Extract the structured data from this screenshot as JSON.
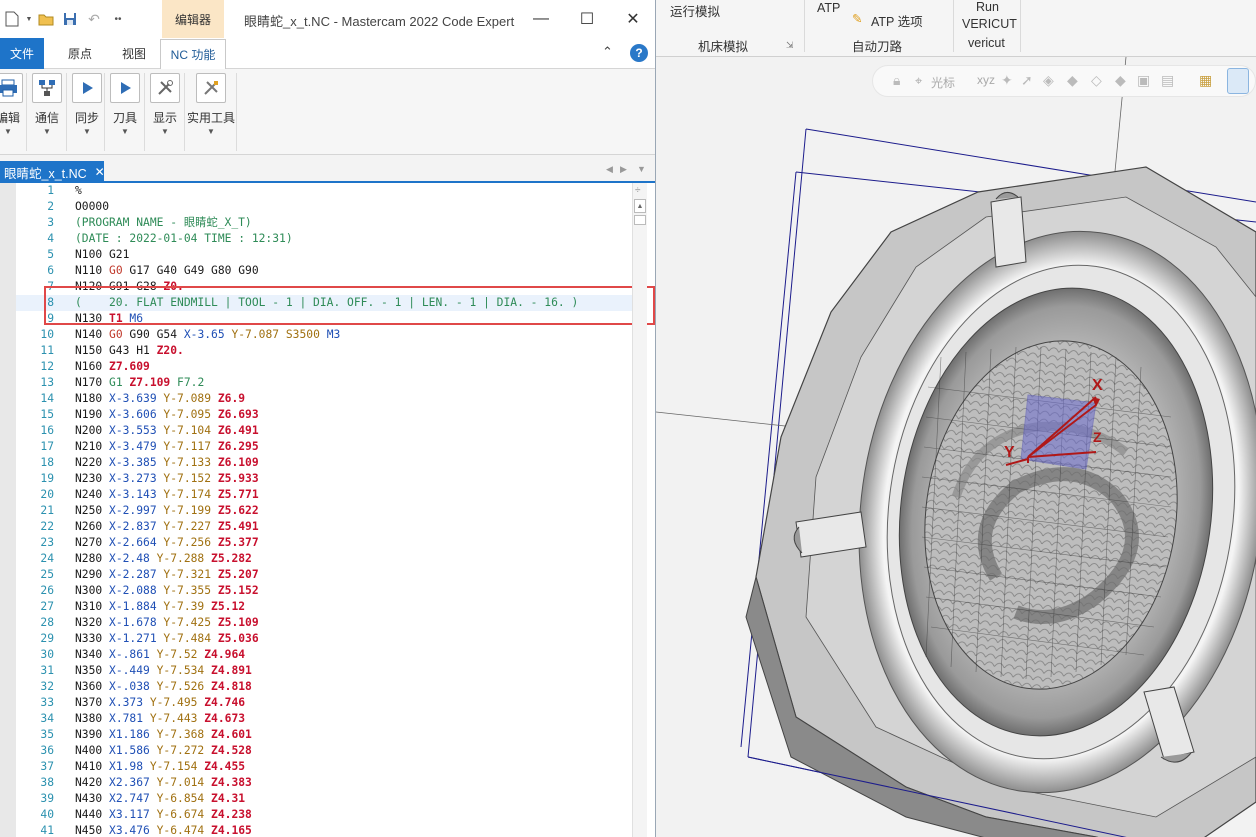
{
  "code_expert": {
    "title": "眼睛蛇_x_t.NC - Mastercam 2022 Code Expert",
    "contextual_tab": "编辑器",
    "window_buttons": {
      "minimize": "—",
      "maximize": "☐",
      "close": "✕"
    },
    "ribbon_tabs": {
      "file": "文件",
      "origin": "原点",
      "view": "视图",
      "nc": "NC 功能"
    },
    "help": "?",
    "ribbon_buttons": {
      "edit": "编辑",
      "comm": "通信",
      "sync": "同步",
      "tool": "刀具",
      "display": "显示",
      "utilities": "实用工具"
    },
    "doc_tab": {
      "label": "眼睛蛇_x_t.NC",
      "close": "✕"
    },
    "lines": [
      [
        "1",
        [
          [
            "o",
            "%"
          ]
        ]
      ],
      [
        "2",
        [
          [
            "o",
            "O0000"
          ]
        ]
      ],
      [
        "3",
        [
          [
            "c",
            "(PROGRAM NAME - 眼睛蛇_X_T)"
          ]
        ]
      ],
      [
        "4",
        [
          [
            "c",
            "(DATE : 2022-01-04 TIME : 12:31)"
          ]
        ]
      ],
      [
        "5",
        [
          [
            "n",
            "N100 G21"
          ]
        ]
      ],
      [
        "6",
        [
          [
            "n",
            "N110 "
          ],
          [
            "g0",
            "G0"
          ],
          [
            "n",
            " G17 G40 G49 G80 G90"
          ]
        ]
      ],
      [
        "7",
        [
          [
            "n",
            "N120 G91 G28 "
          ],
          [
            "z",
            "Z0."
          ]
        ]
      ],
      [
        "8",
        [
          [
            "c",
            "(    20. FLAT ENDMILL | TOOL - 1 | DIA. OFF. - 1 | LEN. - 1 | DIA. - 16. )"
          ]
        ]
      ],
      [
        "9",
        [
          [
            "n",
            "N130 "
          ],
          [
            "t",
            "T1"
          ],
          [
            "m",
            " M6"
          ]
        ]
      ],
      [
        "10",
        [
          [
            "n",
            "N140 "
          ],
          [
            "g0",
            "G0"
          ],
          [
            "n",
            " G90 G54 "
          ],
          [
            "x",
            "X-3.65"
          ],
          [
            "y",
            " Y-7.087"
          ],
          [
            "s",
            " S3500"
          ],
          [
            "m",
            " M3"
          ]
        ]
      ],
      [
        "11",
        [
          [
            "n",
            "N150 G43 H1 "
          ],
          [
            "z",
            "Z20."
          ]
        ]
      ],
      [
        "12",
        [
          [
            "n",
            "N160 "
          ],
          [
            "z",
            "Z7.609"
          ]
        ]
      ],
      [
        "13",
        [
          [
            "n",
            "N170 "
          ],
          [
            "g1",
            "G1"
          ],
          [
            "z",
            " Z7.109"
          ],
          [
            "f",
            " F7.2"
          ]
        ]
      ],
      [
        "14",
        [
          [
            "n",
            "N180 "
          ],
          [
            "x",
            "X-3.639"
          ],
          [
            "y",
            " Y-7.089"
          ],
          [
            "z",
            " Z6.9"
          ]
        ]
      ],
      [
        "15",
        [
          [
            "n",
            "N190 "
          ],
          [
            "x",
            "X-3.606"
          ],
          [
            "y",
            " Y-7.095"
          ],
          [
            "z",
            " Z6.693"
          ]
        ]
      ],
      [
        "16",
        [
          [
            "n",
            "N200 "
          ],
          [
            "x",
            "X-3.553"
          ],
          [
            "y",
            " Y-7.104"
          ],
          [
            "z",
            " Z6.491"
          ]
        ]
      ],
      [
        "17",
        [
          [
            "n",
            "N210 "
          ],
          [
            "x",
            "X-3.479"
          ],
          [
            "y",
            " Y-7.117"
          ],
          [
            "z",
            " Z6.295"
          ]
        ]
      ],
      [
        "18",
        [
          [
            "n",
            "N220 "
          ],
          [
            "x",
            "X-3.385"
          ],
          [
            "y",
            " Y-7.133"
          ],
          [
            "z",
            " Z6.109"
          ]
        ]
      ],
      [
        "19",
        [
          [
            "n",
            "N230 "
          ],
          [
            "x",
            "X-3.273"
          ],
          [
            "y",
            " Y-7.152"
          ],
          [
            "z",
            " Z5.933"
          ]
        ]
      ],
      [
        "20",
        [
          [
            "n",
            "N240 "
          ],
          [
            "x",
            "X-3.143"
          ],
          [
            "y",
            " Y-7.174"
          ],
          [
            "z",
            " Z5.771"
          ]
        ]
      ],
      [
        "21",
        [
          [
            "n",
            "N250 "
          ],
          [
            "x",
            "X-2.997"
          ],
          [
            "y",
            " Y-7.199"
          ],
          [
            "z",
            " Z5.622"
          ]
        ]
      ],
      [
        "22",
        [
          [
            "n",
            "N260 "
          ],
          [
            "x",
            "X-2.837"
          ],
          [
            "y",
            " Y-7.227"
          ],
          [
            "z",
            " Z5.491"
          ]
        ]
      ],
      [
        "23",
        [
          [
            "n",
            "N270 "
          ],
          [
            "x",
            "X-2.664"
          ],
          [
            "y",
            " Y-7.256"
          ],
          [
            "z",
            " Z5.377"
          ]
        ]
      ],
      [
        "24",
        [
          [
            "n",
            "N280 "
          ],
          [
            "x",
            "X-2.48"
          ],
          [
            "y",
            " Y-7.288"
          ],
          [
            "z",
            " Z5.282"
          ]
        ]
      ],
      [
        "25",
        [
          [
            "n",
            "N290 "
          ],
          [
            "x",
            "X-2.287"
          ],
          [
            "y",
            " Y-7.321"
          ],
          [
            "z",
            " Z5.207"
          ]
        ]
      ],
      [
        "26",
        [
          [
            "n",
            "N300 "
          ],
          [
            "x",
            "X-2.088"
          ],
          [
            "y",
            " Y-7.355"
          ],
          [
            "z",
            " Z5.152"
          ]
        ]
      ],
      [
        "27",
        [
          [
            "n",
            "N310 "
          ],
          [
            "x",
            "X-1.884"
          ],
          [
            "y",
            " Y-7.39"
          ],
          [
            "z",
            " Z5.12"
          ]
        ]
      ],
      [
        "28",
        [
          [
            "n",
            "N320 "
          ],
          [
            "x",
            "X-1.678"
          ],
          [
            "y",
            " Y-7.425"
          ],
          [
            "z",
            " Z5.109"
          ]
        ]
      ],
      [
        "29",
        [
          [
            "n",
            "N330 "
          ],
          [
            "x",
            "X-1.271"
          ],
          [
            "y",
            " Y-7.484"
          ],
          [
            "z",
            " Z5.036"
          ]
        ]
      ],
      [
        "30",
        [
          [
            "n",
            "N340 "
          ],
          [
            "x",
            "X-.861"
          ],
          [
            "y",
            " Y-7.52"
          ],
          [
            "z",
            " Z4.964"
          ]
        ]
      ],
      [
        "31",
        [
          [
            "n",
            "N350 "
          ],
          [
            "x",
            "X-.449"
          ],
          [
            "y",
            " Y-7.534"
          ],
          [
            "z",
            " Z4.891"
          ]
        ]
      ],
      [
        "32",
        [
          [
            "n",
            "N360 "
          ],
          [
            "x",
            "X-.038"
          ],
          [
            "y",
            " Y-7.526"
          ],
          [
            "z",
            " Z4.818"
          ]
        ]
      ],
      [
        "33",
        [
          [
            "n",
            "N370 "
          ],
          [
            "x",
            "X.373"
          ],
          [
            "y",
            " Y-7.495"
          ],
          [
            "z",
            " Z4.746"
          ]
        ]
      ],
      [
        "34",
        [
          [
            "n",
            "N380 "
          ],
          [
            "x",
            "X.781"
          ],
          [
            "y",
            " Y-7.443"
          ],
          [
            "z",
            " Z4.673"
          ]
        ]
      ],
      [
        "35",
        [
          [
            "n",
            "N390 "
          ],
          [
            "x",
            "X1.186"
          ],
          [
            "y",
            " Y-7.368"
          ],
          [
            "z",
            " Z4.601"
          ]
        ]
      ],
      [
        "36",
        [
          [
            "n",
            "N400 "
          ],
          [
            "x",
            "X1.586"
          ],
          [
            "y",
            " Y-7.272"
          ],
          [
            "z",
            " Z4.528"
          ]
        ]
      ],
      [
        "37",
        [
          [
            "n",
            "N410 "
          ],
          [
            "x",
            "X1.98"
          ],
          [
            "y",
            " Y-7.154"
          ],
          [
            "z",
            " Z4.455"
          ]
        ]
      ],
      [
        "38",
        [
          [
            "n",
            "N420 "
          ],
          [
            "x",
            "X2.367"
          ],
          [
            "y",
            " Y-7.014"
          ],
          [
            "z",
            " Z4.383"
          ]
        ]
      ],
      [
        "39",
        [
          [
            "n",
            "N430 "
          ],
          [
            "x",
            "X2.747"
          ],
          [
            "y",
            " Y-6.854"
          ],
          [
            "z",
            " Z4.31"
          ]
        ]
      ],
      [
        "40",
        [
          [
            "n",
            "N440 "
          ],
          [
            "x",
            "X3.117"
          ],
          [
            "y",
            " Y-6.674"
          ],
          [
            "z",
            " Z4.238"
          ]
        ]
      ],
      [
        "41",
        [
          [
            "n",
            "N450 "
          ],
          [
            "x",
            "X3.476"
          ],
          [
            "y",
            " Y-6.474"
          ],
          [
            "z",
            " Z4.165"
          ]
        ]
      ]
    ],
    "highlighted_line": "8"
  },
  "mastercam": {
    "ribbon": {
      "run_sim": "运行模拟",
      "machine_sim": "机床模拟",
      "atp": "ATP",
      "atp_options": "ATP 选项",
      "auto_toolpath": "自动刀路",
      "run_vericut_1": "Run",
      "run_vericut_2": "VERICUT",
      "vericut": "vericut"
    },
    "viewport": {
      "cursor_label": "光标",
      "axis_x": "X",
      "axis_y": "Y",
      "axis_z": "Z"
    }
  },
  "colors": {
    "accent": "#1e74c9",
    "selection_box": "#e04848",
    "context_tab": "#fbe6c6"
  }
}
